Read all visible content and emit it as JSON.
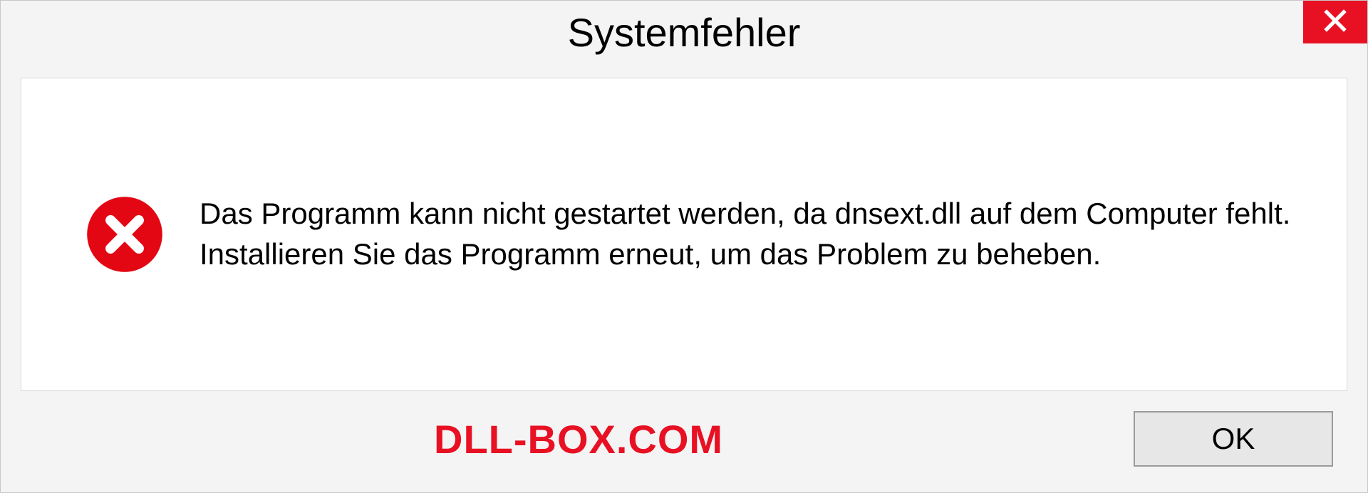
{
  "dialog": {
    "title": "Systemfehler",
    "message": "Das Programm kann nicht gestartet werden, da dnsext.dll auf dem Computer fehlt. Installieren Sie das Programm erneut, um das Problem zu beheben.",
    "ok_label": "OK"
  },
  "watermark": "DLL-BOX.COM",
  "icons": {
    "close": "close-icon",
    "error": "error-circle-x-icon"
  },
  "colors": {
    "close_bg": "#e81123",
    "error_red": "#e30613",
    "watermark_red": "#e81123"
  }
}
